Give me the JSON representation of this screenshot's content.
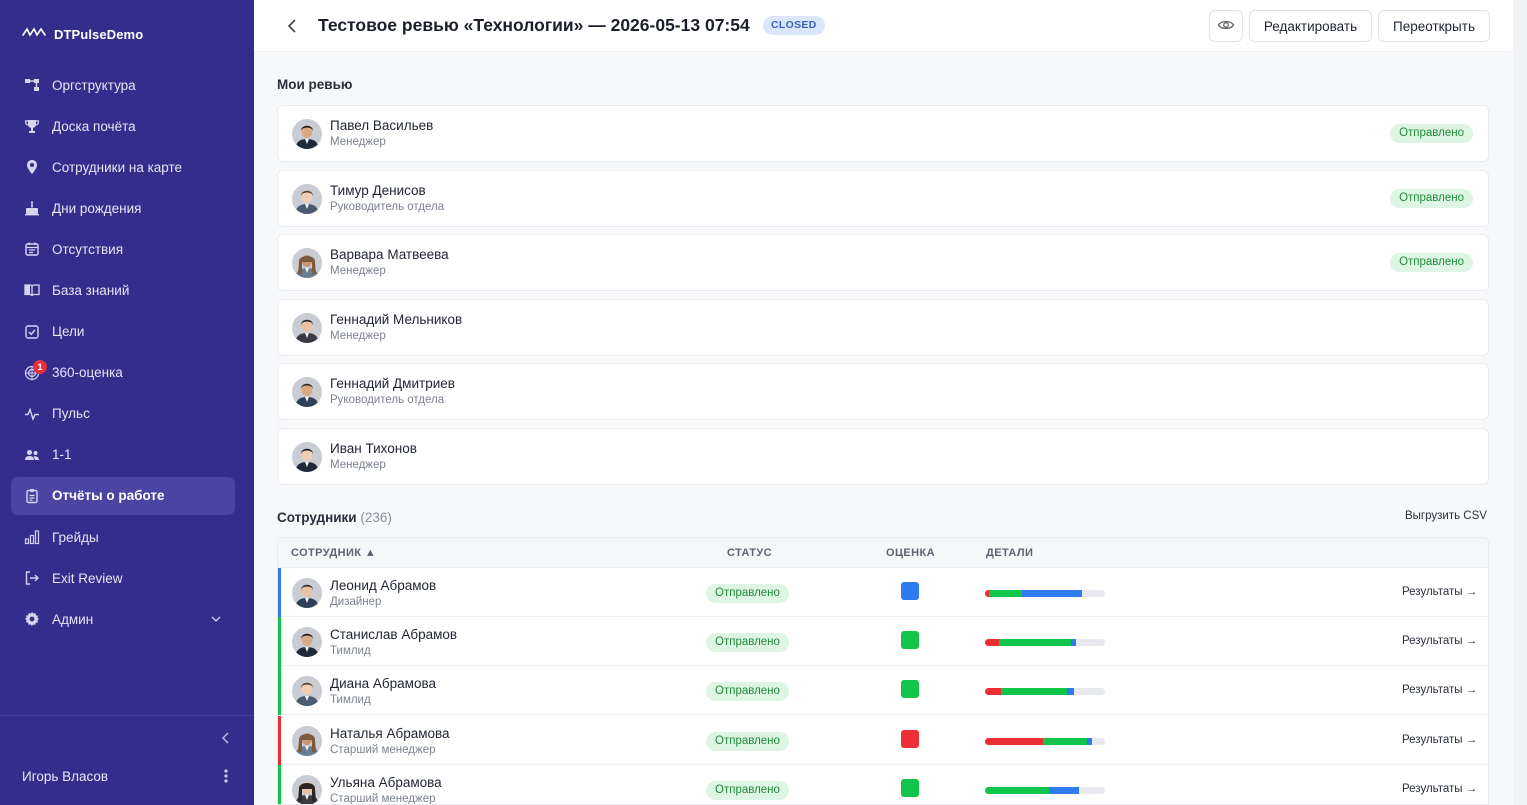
{
  "app": {
    "brand": "DTPulseDemo"
  },
  "sidebar": {
    "items": [
      {
        "label": "Оргструктура",
        "icon": "org-chart-icon"
      },
      {
        "label": "Доска почёта",
        "icon": "trophy-icon"
      },
      {
        "label": "Сотрудники на карте",
        "icon": "map-pin-icon"
      },
      {
        "label": "Дни рождения",
        "icon": "cake-icon"
      },
      {
        "label": "Отсутствия",
        "icon": "calendar-icon"
      },
      {
        "label": "База знаний",
        "icon": "book-icon"
      },
      {
        "label": "Цели",
        "icon": "checkbox-icon"
      },
      {
        "label": "360-оценка",
        "icon": "radar-icon",
        "badge": "1"
      },
      {
        "label": "Пульс",
        "icon": "pulse-icon"
      },
      {
        "label": "1-1",
        "icon": "users-icon"
      },
      {
        "label": "Отчёты о работе",
        "icon": "report-icon",
        "active": true
      },
      {
        "label": "Грейды",
        "icon": "bar-chart-icon"
      },
      {
        "label": "Exit Review",
        "icon": "exit-icon"
      },
      {
        "label": "Админ",
        "icon": "gear-icon",
        "expandable": true
      }
    ],
    "user_name": "Игорь Власов"
  },
  "header": {
    "title": "Тестовое ревью «Технологии» — 2026-05-13 07:54",
    "status_badge": "CLOSED",
    "edit_label": "Редактировать",
    "reopen_label": "Переоткрыть"
  },
  "my_reviews": {
    "title": "Мои ревью",
    "items": [
      {
        "name": "Павел Васильев",
        "role": "Менеджер",
        "status": "Отправлено"
      },
      {
        "name": "Тимур Денисов",
        "role": "Руководитель отдела",
        "status": "Отправлено"
      },
      {
        "name": "Варвара Матвеева",
        "role": "Менеджер",
        "status": "Отправлено"
      },
      {
        "name": "Геннадий Мельников",
        "role": "Менеджер",
        "status": ""
      },
      {
        "name": "Геннадий Дмитриев",
        "role": "Руководитель отдела",
        "status": ""
      },
      {
        "name": "Иван Тихонов",
        "role": "Менеджер",
        "status": ""
      }
    ]
  },
  "employees": {
    "title": "Сотрудники",
    "count": "(236)",
    "export_label": "Выгрузить CSV",
    "columns": {
      "employee": "СОТРУДНИК ▲",
      "status": "СТАТУС",
      "score": "ОЦЕНКА",
      "details": "ДЕТАЛИ"
    },
    "rows": [
      {
        "name": "Леонид Абрамов",
        "role": "Дизайнер",
        "status": "Отправлено",
        "score_color": "#2f7cf0",
        "accent": "#2f7cf0",
        "bar": [
          0.03,
          0.28,
          0.5
        ],
        "link": "Результаты →"
      },
      {
        "name": "Станислав Абрамов",
        "role": "Тимлид",
        "status": "Отправлено",
        "score_color": "#12c44a",
        "accent": "#12c44a",
        "bar": [
          0.12,
          0.6,
          0.04
        ],
        "link": "Результаты →"
      },
      {
        "name": "Диана Абрамова",
        "role": "Тимлид",
        "status": "Отправлено",
        "score_color": "#12c44a",
        "accent": "#12c44a",
        "bar": [
          0.13,
          0.55,
          0.06
        ],
        "link": "Результаты →"
      },
      {
        "name": "Наталья Абрамова",
        "role": "Старший менеджер",
        "status": "Отправлено",
        "score_color": "#ec2f35",
        "accent": "#ec2f35",
        "bar": [
          0.48,
          0.37,
          0.04
        ],
        "link": "Результаты →"
      },
      {
        "name": "Ульяна Абрамова",
        "role": "Старший менеджер",
        "status": "Отправлено",
        "score_color": "#12c44a",
        "accent": "#12c44a",
        "bar": [
          0.0,
          0.53,
          0.25
        ],
        "link": "Результаты →"
      }
    ]
  },
  "colors": {
    "sidebar_bg": "#332e8c",
    "bar_red": "#ec2f35",
    "bar_green": "#12c44a",
    "bar_blue": "#2f7cf0"
  }
}
